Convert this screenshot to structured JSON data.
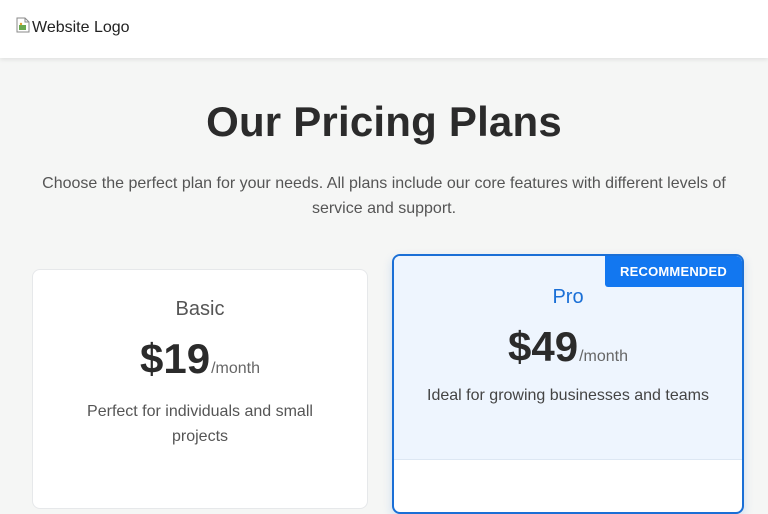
{
  "header": {
    "logo_alt": "Website Logo"
  },
  "hero": {
    "title": "Our Pricing Plans",
    "subtitle": "Choose the perfect plan for your needs. All plans include our core features with different levels of service and support."
  },
  "plans": [
    {
      "name": "Basic",
      "price": "$19",
      "period": "/month",
      "description": "Perfect for individuals and small projects",
      "recommended": false
    },
    {
      "name": "Pro",
      "price": "$49",
      "period": "/month",
      "description": "Ideal for growing businesses and teams",
      "recommended": true,
      "badge": "RECOMMENDED"
    }
  ],
  "colors": {
    "accent": "#1277f0",
    "pro_border": "#1a6fd6",
    "pro_header_bg": "#eef5fe",
    "page_bg": "#f5f6f5"
  },
  "icons": {
    "logo": "broken-image-icon"
  }
}
